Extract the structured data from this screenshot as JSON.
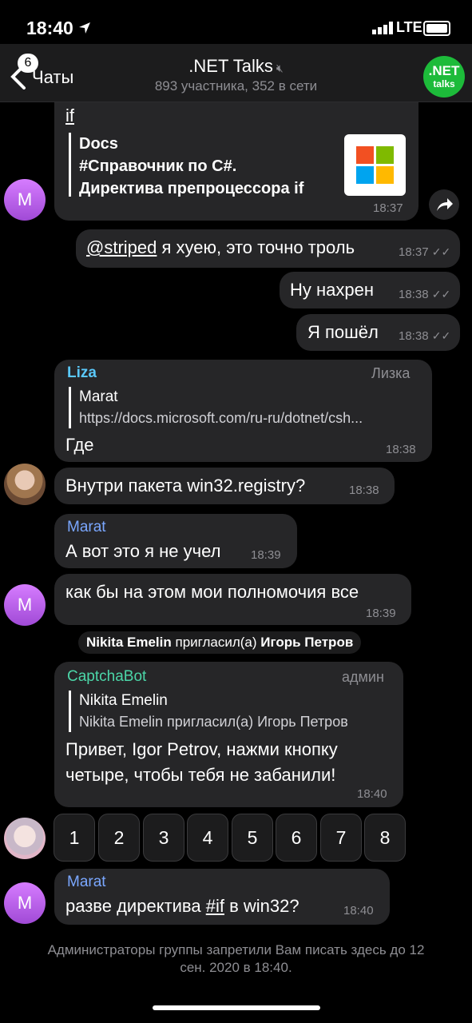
{
  "status_bar": {
    "time": "18:40",
    "network": "LTE"
  },
  "header": {
    "back_label": "Чаты",
    "unread_badge": "6",
    "title": ".NET Talks",
    "subtitle": "893 участника, 352 в сети",
    "avatar_text_line1": ".NET",
    "avatar_text_line2": "talks"
  },
  "messages": {
    "m1": {
      "link_text": "if",
      "preview_site": "Docs",
      "preview_line1": "#Справочник по C#.",
      "preview_line2": "Директива препроцессора if",
      "time": "18:37",
      "avatar": "M"
    },
    "m2": {
      "mention": "@striped",
      "text": " я хуею, это точно троль",
      "time": "18:37"
    },
    "m3": {
      "text": "Ну нахрен",
      "time": "18:38"
    },
    "m4": {
      "text": "Я пошёл",
      "time": "18:38"
    },
    "m5": {
      "sender": "Liza",
      "title": "Лизка",
      "quote_author": "Marat",
      "quote_text": "https://docs.microsoft.com/ru-ru/dotnet/csh...",
      "text": "Где",
      "time": "18:38"
    },
    "m6": {
      "text": "Внутри пакета win32.registry?",
      "time": "18:38"
    },
    "m7": {
      "sender": "Marat",
      "text": "А вот это я не учел",
      "time": "18:39"
    },
    "m8": {
      "text": "как бы на этом мои полномочия все",
      "time": "18:39",
      "avatar": "M"
    },
    "service": {
      "actor": "Nikita Emelin",
      "action": " пригласил(а) ",
      "target": "Игорь Петров"
    },
    "m9": {
      "sender": "CaptchaBot",
      "title": "админ",
      "quote_author": "Nikita Emelin",
      "quote_text": "Nikita Emelin пригласил(а) Игорь Петров",
      "text_line1": "Привет, Igor Petrov, нажми кнопку",
      "text_line2": "четыре, чтобы тебя не забанили!",
      "time": "18:40"
    },
    "m10": {
      "sender": "Marat",
      "text_before": "разве директива ",
      "hashtag": "#if",
      "text_after": " в win32?",
      "time": "18:40",
      "avatar": "M"
    }
  },
  "keyboard": [
    "1",
    "2",
    "3",
    "4",
    "5",
    "6",
    "7",
    "8"
  ],
  "notice_line1": "Администраторы группы запретили Вам писать здесь до 12",
  "notice_line2": "сен. 2020 в 18:40.",
  "colors": {
    "liza": "#5ac8fa",
    "marat": "#7aa7ff",
    "captcha": "#4cd6a8",
    "link": "#ffffff"
  }
}
